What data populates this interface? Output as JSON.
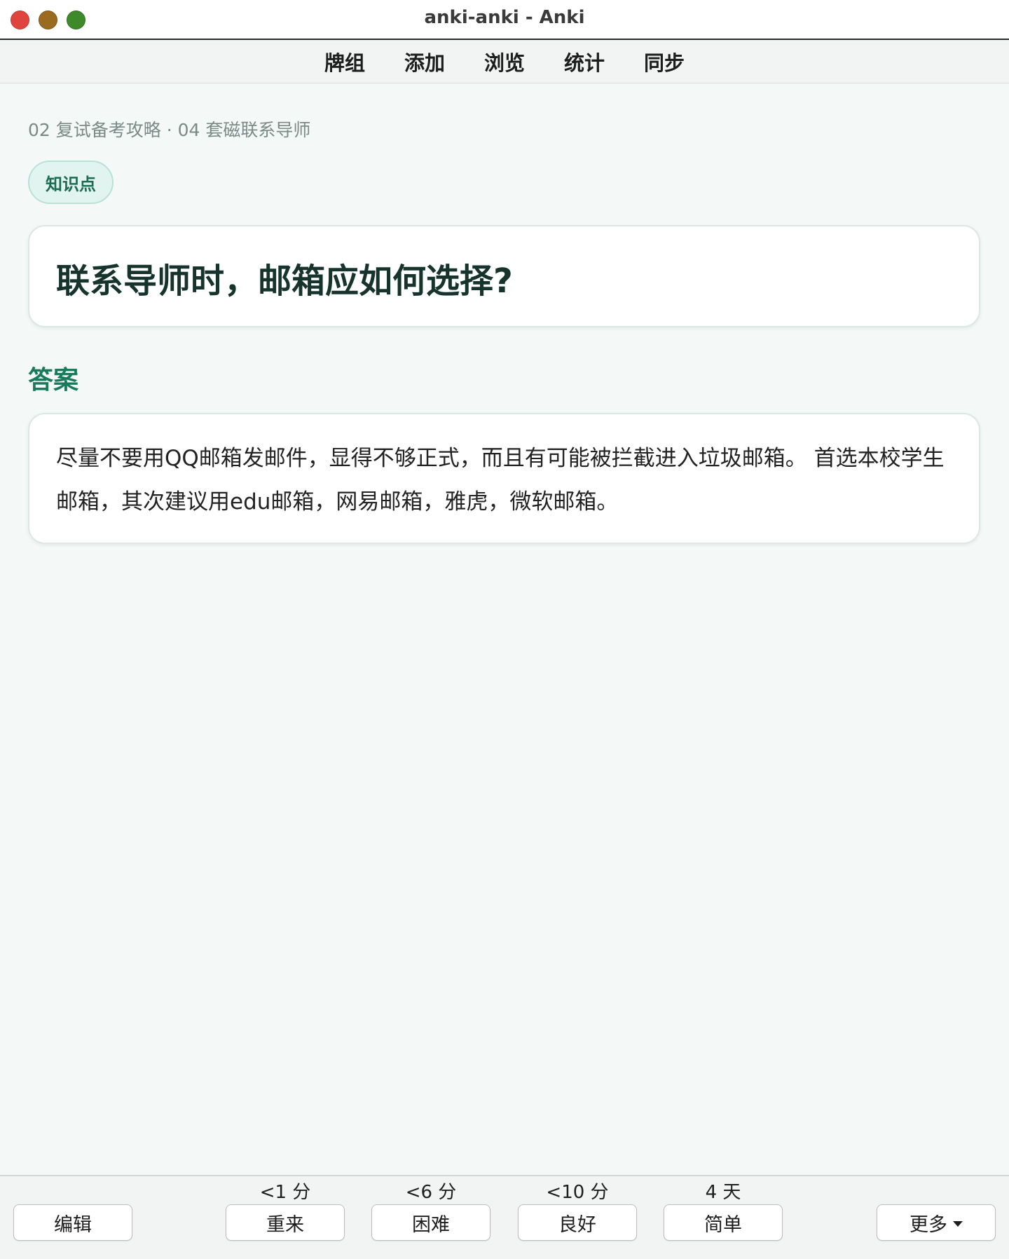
{
  "window": {
    "title": "anki-anki - Anki"
  },
  "topmenu": {
    "items": [
      "牌组",
      "添加",
      "浏览",
      "统计",
      "同步"
    ]
  },
  "card": {
    "breadcrumb": "02 复试备考攻略 · 04 套磁联系导师",
    "tag": "知识点",
    "question": "联系导师时，邮箱应如何选择?",
    "answer_heading": "答案",
    "answer": "尽量不要用QQ邮箱发邮件，显得不够正式，而且有可能被拦截进入垃圾邮箱。 首选本校学生邮箱，其次建议用edu邮箱，网易邮箱，雅虎，微软邮箱。"
  },
  "bottombar": {
    "edit_label": "编辑",
    "answers": [
      {
        "interval": "<1 分",
        "label": "重来"
      },
      {
        "interval": "<6 分",
        "label": "困难"
      },
      {
        "interval": "<10 分",
        "label": "良好"
      },
      {
        "interval": "4 天",
        "label": "简单"
      }
    ],
    "more_label": "更多"
  },
  "colors": {
    "accent": "#1b7a5c",
    "background": "#f4f8f7",
    "tag_background": "#e2f4ef"
  }
}
